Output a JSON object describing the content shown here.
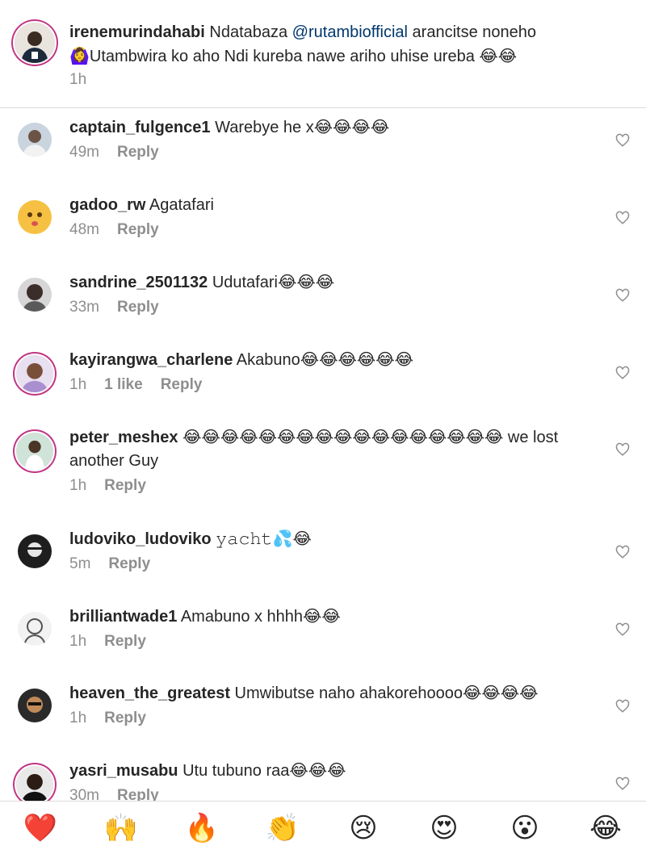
{
  "caption": {
    "username": "irenemurindahabi",
    "text_before": "Ndatabaza ",
    "mention": "@rutambiofficial",
    "text_after": " arancitse noneho 🙆‍♀️Utambwira ko aho Ndi kureba nawe ariho uhise ureba 😂😂",
    "time": "1h"
  },
  "comments": [
    {
      "username": "captain_fulgence1",
      "text": "Warebye he x😂😂😂😂",
      "time": "49m",
      "reply": "Reply"
    },
    {
      "username": "gadoo_rw",
      "text": "Agatafari",
      "time": "48m",
      "reply": "Reply"
    },
    {
      "username": "sandrine_2501132",
      "text": "Udutafari😂😂😂",
      "time": "33m",
      "reply": "Reply"
    },
    {
      "username": "kayirangwa_charlene",
      "text": "Akabuno😂😂😂😂😂😂",
      "time": "1h",
      "likes": "1 like",
      "reply": "Reply"
    },
    {
      "username": "peter_meshex",
      "text": "😂😂😂😂😂😂😂😂😂😂😂😂😂😂😂😂😂 we lost another Guy",
      "time": "1h",
      "reply": "Reply"
    },
    {
      "username": "ludoviko_ludoviko",
      "text": "𝚢𝚊𝚌𝚑𝚝💦😂",
      "time": "5m",
      "reply": "Reply"
    },
    {
      "username": "brilliantwade1",
      "text": "Amabuno x hhhh😂😂",
      "time": "1h",
      "reply": "Reply"
    },
    {
      "username": "heaven_the_greatest",
      "text": "Umwibutse naho ahakorehoooo😂😂😂😂",
      "time": "1h",
      "reply": "Reply"
    },
    {
      "username": "yasri_musabu",
      "text": "Utu tubuno raa😂😂😂",
      "time": "30m",
      "reply": "Reply"
    }
  ],
  "emoji_bar": [
    "❤️",
    "🙌",
    "🔥",
    "👏",
    "😢",
    "😍",
    "😮",
    "😂"
  ]
}
